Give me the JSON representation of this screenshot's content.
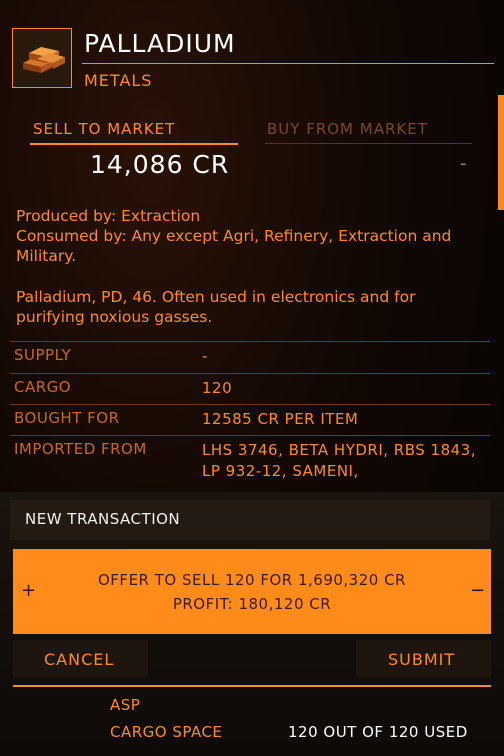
{
  "commodity": {
    "icon": "palladium-bars-icon",
    "name": "PALLADIUM",
    "category": "METALS"
  },
  "tabs": {
    "sell_label": "SELL TO MARKET",
    "buy_label": "BUY FROM MARKET",
    "sell_price": "14,086 CR",
    "buy_price": "-"
  },
  "description": {
    "production": "Produced by: Extraction\nConsumed by: Any except Agri, Refinery, Extraction and Military.",
    "info": "Palladium, PD, 46. Often used in electronics and for purifying noxious gasses."
  },
  "info_table": [
    {
      "label": "SUPPLY",
      "value": "-"
    },
    {
      "label": "CARGO",
      "value": "120"
    },
    {
      "label": "BOUGHT FOR",
      "value": "12585 CR PER ITEM"
    },
    {
      "label": "IMPORTED FROM",
      "value": "LHS 3746, BETA HYDRI, RBS 1843, LP 932-12, SAMENI,"
    }
  ],
  "transaction": {
    "title": "NEW TRANSACTION",
    "increase": "+",
    "decrease": "−",
    "offer_line1": "OFFER TO SELL 120 FOR 1,690,320 CR",
    "offer_line2": "PROFIT: 180,120 CR",
    "cancel_label": "CANCEL",
    "submit_label": "SUBMIT"
  },
  "ship": {
    "name": "ASP",
    "cargo_label": "CARGO SPACE",
    "cargo_value": "120 OUT OF 120 USED"
  },
  "colors": {
    "accent": "#ff8c1a",
    "dim": "#7a4a20",
    "panel": "#1e150e"
  }
}
